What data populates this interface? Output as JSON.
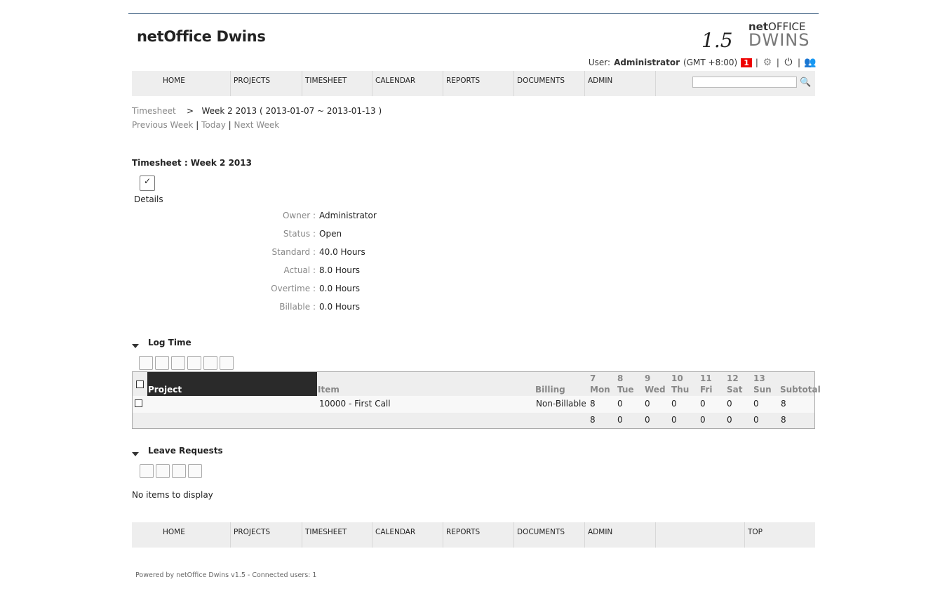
{
  "app_title": "netOffice Dwins",
  "logo": {
    "version": "1.5",
    "net": "net",
    "office": "OFFICE",
    "dwins": "DWINS"
  },
  "user": {
    "label": "User:",
    "name": "Administrator",
    "timezone": "(GMT +8:00)",
    "notifications": "1",
    "sep": "|"
  },
  "nav": [
    "HOME",
    "PROJECTS",
    "TIMESHEET",
    "CALENDAR",
    "REPORTS",
    "DOCUMENTS",
    "ADMIN"
  ],
  "search": {
    "value": "",
    "placeholder": ""
  },
  "breadcrumb": {
    "root": "Timesheet",
    "sep": ">",
    "current": "Week 2 2013 ( 2013-01-07 ~ 2013-01-13 )"
  },
  "weeknav": {
    "prev": "Previous Week",
    "today": "Today",
    "next": "Next Week",
    "sep": "|"
  },
  "page_title": "Timesheet : Week 2 2013",
  "details_label": "Details",
  "fields": [
    {
      "label": "Owner :",
      "value": "Administrator"
    },
    {
      "label": "Status :",
      "value": "Open"
    },
    {
      "label": "Standard :",
      "value": "40.0 Hours"
    },
    {
      "label": "Actual :",
      "value": "8.0 Hours"
    },
    {
      "label": "Overtime :",
      "value": "0.0 Hours"
    },
    {
      "label": "Billable :",
      "value": "0.0 Hours"
    }
  ],
  "log_time": {
    "title": "Log Time",
    "columns": {
      "project": "Project",
      "item": "Item",
      "billing": "Billing",
      "subtotal": "Subtotal",
      "days": [
        {
          "d": "7",
          "w": "Mon"
        },
        {
          "d": "8",
          "w": "Tue"
        },
        {
          "d": "9",
          "w": "Wed"
        },
        {
          "d": "10",
          "w": "Thu"
        },
        {
          "d": "11",
          "w": "Fri"
        },
        {
          "d": "12",
          "w": "Sat"
        },
        {
          "d": "13",
          "w": "Sun"
        }
      ]
    },
    "rows": [
      {
        "project": "",
        "item": "10000 - First Call",
        "billing": "Non-Billable",
        "hours": [
          "8",
          "0",
          "0",
          "0",
          "0",
          "0",
          "0"
        ],
        "subtotal": "8"
      }
    ],
    "totals": {
      "hours": [
        "8",
        "0",
        "0",
        "0",
        "0",
        "0",
        "0"
      ],
      "subtotal": "8"
    }
  },
  "leave": {
    "title": "Leave Requests",
    "empty": "No items to display"
  },
  "footer_nav": [
    "HOME",
    "PROJECTS",
    "TIMESHEET",
    "CALENDAR",
    "REPORTS",
    "DOCUMENTS",
    "ADMIN",
    "",
    "TOP"
  ],
  "powered": "Powered by netOffice Dwins v1.5 - Connected users: 1"
}
